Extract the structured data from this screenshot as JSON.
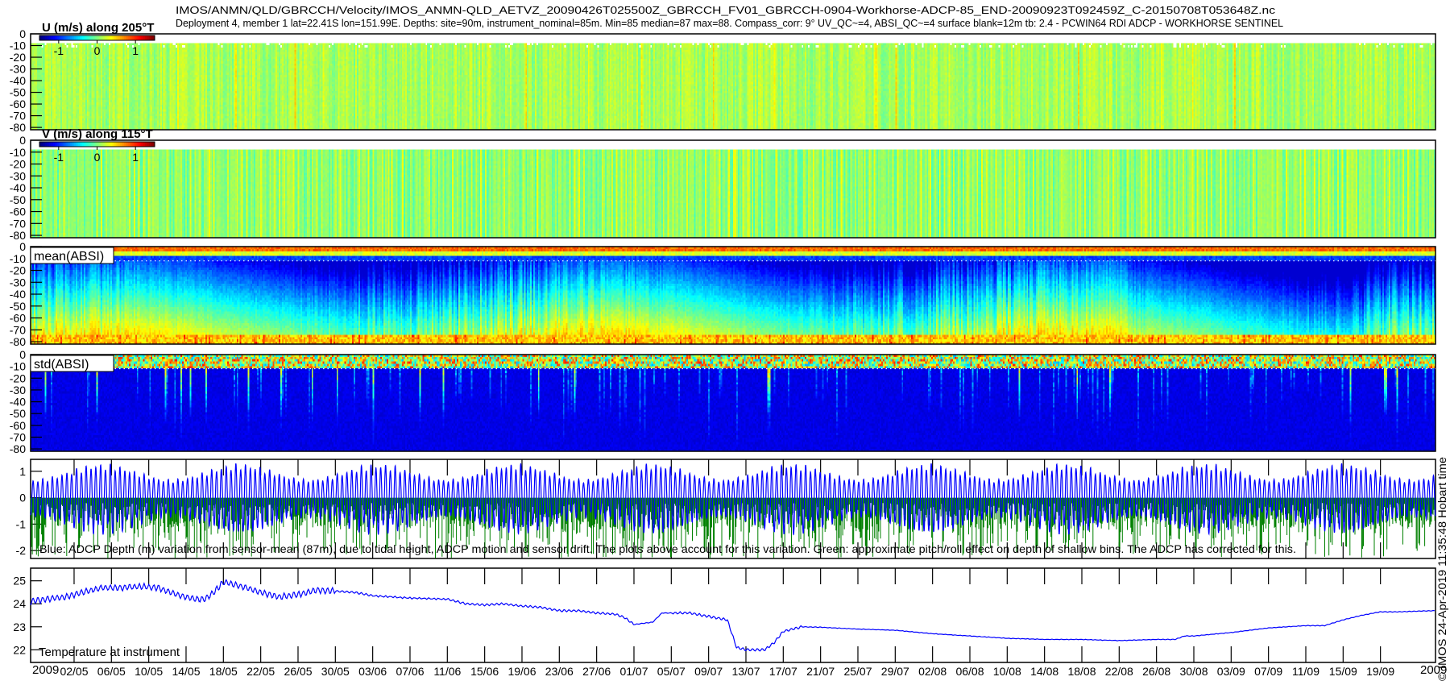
{
  "header": {
    "line1": "IMOS/ANMN/QLD/GBRCCH/Velocity/IMOS_ANMN-QLD_AETVZ_20090426T025500Z_GBRCCH_FV01_GBRCCH-0904-Workhorse-ADCP-85_END-20090923T092459Z_C-20150708T053648Z.nc",
    "line2": "Deployment 4, member 1 lat=22.41S lon=151.99E. Depths: site=90m, instrument_nominal=85m. Min=85 median=87 max=88. Compass_corr: 9° UV_QC~=4, ABSI_QC~=4 surface blank=12m tb: 2.4 - PCWIN64 RDI ADCP - WORKHORSE SENTINEL"
  },
  "footer": {
    "credit": "© IMOS 24-Apr-2019 11:35:48 Hobart time",
    "year_left": "2009",
    "year_right": "2009"
  },
  "colors": {
    "axis": "#000000",
    "depth_line": "#0000ff",
    "pitchroll_line": "#008000",
    "temp_line": "#0000ff",
    "blank_line": "#ffffff"
  },
  "chart_data": [
    {
      "type": "heatmap",
      "id": "u",
      "title": "U (m/s) along 205°T",
      "colorbar": {
        "range": [
          -1.5,
          1.5
        ],
        "ticks": [
          -1,
          0,
          1
        ],
        "tick_labels": [
          "-1",
          "0",
          "1"
        ],
        "colormap": "jet"
      },
      "ylim": [
        -82,
        0
      ],
      "yticks": [
        0,
        -10,
        -20,
        -30,
        -40,
        -50,
        -60,
        -70,
        -80
      ],
      "field": "mostly near 0.2 m/s with tidal striping, gaps near surface"
    },
    {
      "type": "heatmap",
      "id": "v",
      "title": "V (m/s) along 115°T",
      "colorbar": {
        "range": [
          -1.5,
          1.5
        ],
        "ticks": [
          -1,
          0,
          1
        ],
        "tick_labels": [
          "-1",
          "0",
          "1"
        ],
        "colormap": "jet"
      },
      "ylim": [
        -82,
        0
      ],
      "yticks": [
        0,
        -10,
        -20,
        -30,
        -40,
        -50,
        -60,
        -70,
        -80
      ]
    },
    {
      "type": "heatmap",
      "id": "mean_absi",
      "title": "mean(ABSI)",
      "ylim": [
        -82,
        0
      ],
      "yticks": [
        0,
        -10,
        -20,
        -30,
        -40,
        -50,
        -60,
        -70,
        -80
      ],
      "surface_blank_depth": -12
    },
    {
      "type": "heatmap",
      "id": "std_absi",
      "title": "std(ABSI)",
      "ylim": [
        -82,
        0
      ],
      "yticks": [
        0,
        -10,
        -20,
        -30,
        -40,
        -50,
        -60,
        -70,
        -80
      ],
      "surface_blank_depth": -12
    },
    {
      "type": "line",
      "id": "depth",
      "ylim": [
        -2.3,
        1.45
      ],
      "yticks": [
        1,
        0,
        -1,
        -2
      ],
      "ytick_labels": [
        "1",
        "0",
        "-1",
        "-2"
      ],
      "caption": "Blue: ADCP Depth (m) variation from sensor-mean (87m), due to tidal height, ADCP motion and sensor drift. The plots above account for this variation. Green: approximate pitch/roll effect on depth of shallow bins. The ADCP has corrected for this.",
      "series": [
        {
          "name": "ADCP depth variation",
          "tidal_period_hours": 12.42,
          "spring_neap_days": 14.77,
          "amplitude_range": [
            0.7,
            1.3
          ]
        },
        {
          "name": "pitch/roll effect",
          "min": -2.3,
          "max": 0
        }
      ]
    },
    {
      "type": "line",
      "id": "temperature",
      "label": "Temperature at instrument",
      "ylim": [
        21.45,
        25.55
      ],
      "yticks": [
        25,
        24,
        23,
        22
      ],
      "ytick_labels": [
        "25",
        "24",
        "23",
        "22"
      ],
      "x_unit": "day of year 2009",
      "x": [
        117.3,
        119,
        121,
        123,
        125,
        127,
        129,
        131,
        133,
        135,
        136,
        137,
        138,
        140,
        142,
        144,
        146,
        148,
        150,
        152,
        154,
        158,
        162,
        164,
        166,
        168,
        170,
        172,
        174,
        176,
        178,
        180,
        181,
        182,
        184,
        185,
        188,
        190,
        192,
        193,
        194,
        196,
        197,
        198,
        200,
        202,
        206,
        210,
        214,
        218,
        222,
        226,
        230,
        234,
        238,
        240,
        241,
        242,
        246,
        250,
        254,
        256,
        258,
        260,
        262,
        264,
        266,
        267.9
      ],
      "y": [
        24.1,
        24.2,
        24.3,
        24.5,
        24.7,
        24.7,
        24.75,
        24.7,
        24.4,
        24.2,
        24.2,
        24.5,
        24.95,
        24.75,
        24.5,
        24.3,
        24.4,
        24.6,
        24.55,
        24.5,
        24.35,
        24.25,
        24.2,
        24.0,
        23.95,
        24.0,
        23.9,
        23.85,
        23.7,
        23.7,
        23.6,
        23.55,
        23.4,
        23.1,
        23.2,
        23.6,
        23.6,
        23.45,
        23.3,
        22.1,
        22.0,
        22.0,
        22.3,
        22.8,
        23.0,
        22.98,
        22.9,
        22.85,
        22.7,
        22.6,
        22.5,
        22.45,
        22.45,
        22.4,
        22.45,
        22.45,
        22.6,
        22.6,
        22.75,
        22.95,
        23.05,
        23.05,
        23.3,
        23.5,
        23.65,
        23.65,
        23.68,
        23.7
      ]
    }
  ],
  "xaxis": {
    "xlim_doy": [
      117.34,
      267.9
    ],
    "tick_doy": [
      122,
      126,
      130,
      134,
      138,
      142,
      146,
      150,
      154,
      158,
      162,
      166,
      170,
      174,
      178,
      182,
      186,
      190,
      194,
      198,
      202,
      206,
      210,
      214,
      218,
      222,
      226,
      230,
      234,
      238,
      242,
      246,
      250,
      254,
      258,
      262
    ],
    "tick_labels": [
      "02/05",
      "06/05",
      "10/05",
      "14/05",
      "18/05",
      "22/05",
      "26/05",
      "30/05",
      "03/06",
      "07/06",
      "11/06",
      "15/06",
      "19/06",
      "23/06",
      "27/06",
      "01/07",
      "05/07",
      "09/07",
      "13/07",
      "17/07",
      "21/07",
      "25/07",
      "29/07",
      "02/08",
      "06/08",
      "10/08",
      "14/08",
      "18/08",
      "22/08",
      "26/08",
      "30/08",
      "03/09",
      "07/09",
      "11/09",
      "15/09",
      "19/09"
    ]
  }
}
